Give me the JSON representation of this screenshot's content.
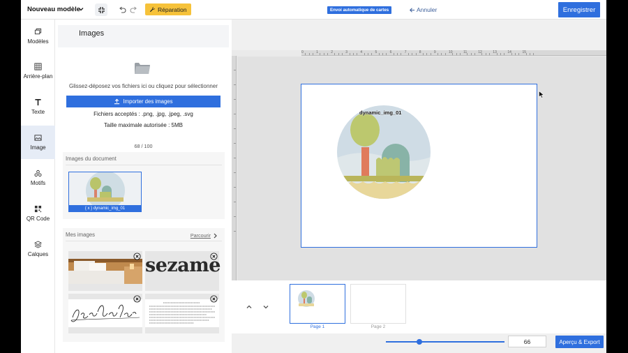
{
  "toolbar": {
    "model_name": "Nouveau modèle",
    "repair_label": "Réparation",
    "auto_badge": "Envoi automatique de cartes",
    "cancel_label": "Annuler",
    "save_label": "Enregistrer"
  },
  "sidebar": {
    "items": [
      {
        "label": "Modèles",
        "icon": "layers-icon"
      },
      {
        "label": "Arrière-plan",
        "icon": "grid-icon"
      },
      {
        "label": "Texte",
        "icon": "text-icon"
      },
      {
        "label": "Image",
        "icon": "image-icon",
        "active": true
      },
      {
        "label": "Motifs",
        "icon": "shapes-icon"
      },
      {
        "label": "QR Code",
        "icon": "qr-code-icon"
      },
      {
        "label": "Calques",
        "icon": "stack-icon"
      }
    ]
  },
  "panel": {
    "title": "Images",
    "drop_text": "Glissez-déposez vos fichiers ici ou cliquez pour sélectionner",
    "import_label": "Importer des images",
    "accepted": "Fichiers acceptés : .png, .jpg, .jpeg, .svg",
    "max_size": "Taille maximale autorisée : 5MB",
    "count": "68 / 100",
    "document_images_label": "Images du document",
    "document_image_name": "{ x } dynamic_img_01",
    "my_images_label": "Mes images",
    "browse_label": "Parcourir",
    "my_images": [
      {
        "name": "bedroom-photo"
      },
      {
        "name": "sezame-logo",
        "text": "sezame"
      },
      {
        "name": "signature",
        "text": "Jean-Pierre Nadir"
      },
      {
        "name": "text-document"
      }
    ]
  },
  "canvas": {
    "ruler_labels": [
      "0",
      "1",
      "2",
      "3",
      "4",
      "5",
      "6",
      "7",
      "8",
      "9",
      "10",
      "11",
      "12",
      "13",
      "14",
      "15"
    ],
    "element_label": "dynamic_img_01"
  },
  "pages": [
    {
      "label": "Page 1",
      "active": true
    },
    {
      "label": "Page 2",
      "active": false
    }
  ],
  "zoom": {
    "value": "66",
    "slider_fraction": 0.28
  },
  "preview_label": "Aperçu & Export",
  "colors": {
    "accent": "#2f6fde",
    "repair": "#f6c23a"
  }
}
